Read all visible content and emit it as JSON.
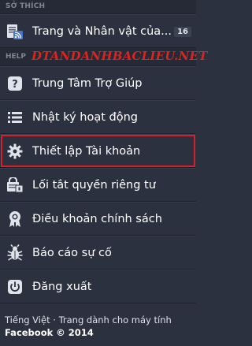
{
  "favorites": {
    "header": "SỞ THÍCH",
    "pages_item": {
      "label": "Trang và Nhân vật của...",
      "count": "16",
      "icon": "pages-feed-icon"
    }
  },
  "help": {
    "header": "HELP",
    "watermark": "dtandanhbaclieu.net",
    "items": [
      {
        "label": "Trung Tâm Trợ Giúp",
        "icon": "question-icon"
      },
      {
        "label": "Nhật ký hoạt động",
        "icon": "list-icon"
      },
      {
        "label": "Thiết lập Tài khoản",
        "icon": "gear-icon",
        "highlighted": true
      },
      {
        "label": "Lối tắt quyền riêng tư",
        "icon": "privacy-lock-icon"
      },
      {
        "label": "Điều khoản chính sách",
        "icon": "badge-ribbon-icon"
      },
      {
        "label": "Báo cáo sự cố",
        "icon": "bug-icon"
      },
      {
        "label": "Đăng xuất",
        "icon": "power-icon"
      }
    ]
  },
  "footer": {
    "language": "Tiếng Việt",
    "separator": "·",
    "mobile_link": "Trang dành cho máy tính",
    "copyright": "Facebook © 2014"
  },
  "colors": {
    "background": "#2c3140",
    "highlight_border": "#d2212b",
    "watermark": "#d9241f"
  }
}
